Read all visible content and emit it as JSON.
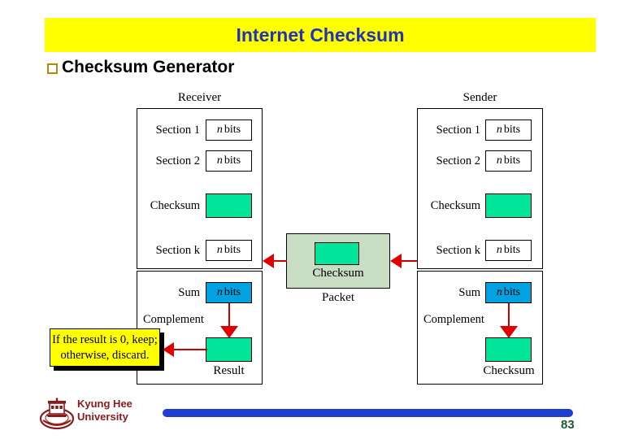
{
  "slide": {
    "title": "Internet Checksum",
    "title_bg_color": "#ffff00",
    "title_text_color": "#2233bb",
    "bullet": {
      "marker_icon": "square-bullet-icon",
      "marker_color": "#b8860b",
      "label": "Checksum Generator"
    }
  },
  "diagram": {
    "receiver": {
      "title": "Receiver",
      "rows": [
        {
          "label": "Section 1",
          "value": "n bits",
          "box_type": "outline"
        },
        {
          "label": "Section 2",
          "value": "n bits",
          "box_type": "outline"
        },
        {
          "label": "Checksum",
          "value": "",
          "box_type": "green"
        },
        {
          "label": "Section k",
          "value": "n bits",
          "box_type": "outline"
        }
      ],
      "lower": {
        "sum_label": "Sum",
        "sum_value": "n bits",
        "complement_label": "Complement",
        "result_caption": "Result",
        "result_box_color": "#00e599",
        "sum_box_color": "#00a3e0"
      }
    },
    "sender": {
      "title": "Sender",
      "rows": [
        {
          "label": "Section 1",
          "value": "n bits",
          "box_type": "outline"
        },
        {
          "label": "Section 2",
          "value": "n bits",
          "box_type": "outline"
        },
        {
          "label": "Checksum",
          "value": "",
          "box_type": "green"
        },
        {
          "label": "Section k",
          "value": "n bits",
          "box_type": "outline"
        }
      ],
      "lower": {
        "sum_label": "Sum",
        "sum_value": "n bits",
        "complement_label": "Complement",
        "result_caption": "Checksum",
        "result_box_color": "#00e599",
        "sum_box_color": "#00a3e0"
      }
    },
    "packet": {
      "inner_label": "Checksum",
      "caption": "Packet",
      "bg_color": "#c9dcc4",
      "inner_box_color": "#00e599"
    },
    "callout": {
      "line1": "If the result is 0, keep;",
      "line2": "otherwise, discard.",
      "bg_color": "#ffff00"
    },
    "arrow_color": "#cc0000"
  },
  "footer": {
    "logo_icon": "kyung-hee-crest-icon",
    "university_line1": "Kyung Hee",
    "university_line2": "University",
    "university_color": "#8b1a1a",
    "bar_color": "#1f3fd0",
    "page_number": "83",
    "page_number_color": "#1a5c2e"
  }
}
